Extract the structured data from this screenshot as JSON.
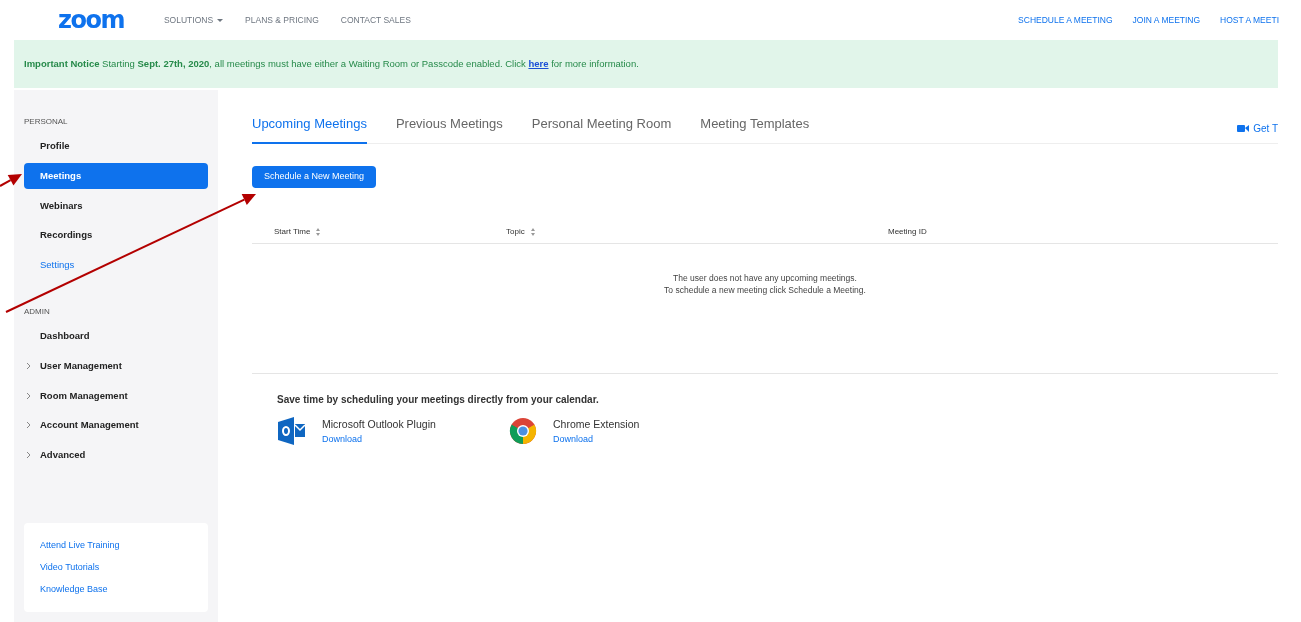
{
  "header": {
    "logo": "zoom",
    "nav": [
      {
        "label": "SOLUTIONS",
        "dropdown": true
      },
      {
        "label": "PLANS & PRICING",
        "dropdown": false
      },
      {
        "label": "CONTACT SALES",
        "dropdown": false
      }
    ],
    "actions": [
      "SCHEDULE A MEETING",
      "JOIN A MEETING",
      "HOST A MEETI"
    ]
  },
  "notice": {
    "text": "**Important Notice** Starting **Sept. 27th, 2020**, all meetings must have either a Waiting Room or Passcode enabled. Click",
    "link": "here",
    "after": "for more information."
  },
  "sidebar": {
    "sections": [
      {
        "title": "PERSONAL",
        "items": [
          {
            "label": "Profile",
            "kind": "page",
            "selected": false
          },
          {
            "label": "Meetings",
            "kind": "page",
            "selected": true
          },
          {
            "label": "Webinars",
            "kind": "page",
            "selected": false
          },
          {
            "label": "Recordings",
            "kind": "page",
            "selected": false
          },
          {
            "label": "Settings",
            "kind": "link",
            "selected": false
          }
        ]
      },
      {
        "title": "ADMIN",
        "items": [
          {
            "label": "Dashboard",
            "kind": "page",
            "selected": false
          },
          {
            "label": "User Management",
            "kind": "group",
            "selected": false
          },
          {
            "label": "Room Management",
            "kind": "group",
            "selected": false
          },
          {
            "label": "Account Management",
            "kind": "group",
            "selected": false
          },
          {
            "label": "Advanced",
            "kind": "group",
            "selected": false
          }
        ]
      }
    ],
    "help_links": [
      "Attend Live Training",
      "Video Tutorials",
      "Knowledge Base"
    ]
  },
  "tabs": [
    {
      "label": "Upcoming Meetings",
      "selected": true
    },
    {
      "label": "Previous Meetings",
      "selected": false
    },
    {
      "label": "Personal Meeting Room",
      "selected": false
    },
    {
      "label": "Meeting Templates",
      "selected": false
    }
  ],
  "get_link": "Get T",
  "schedule_button": "Schedule a New Meeting",
  "table": {
    "columns": [
      {
        "label": "Start Time",
        "sortable": true
      },
      {
        "label": "Topic",
        "sortable": true
      },
      {
        "label": "Meeting ID",
        "sortable": false
      }
    ],
    "empty_message": [
      "The user does not have any upcoming meetings.",
      "To schedule a new meeting click Schedule a Meeting."
    ]
  },
  "calendar": {
    "heading": "Save time by scheduling your meetings directly from your calendar.",
    "plugins": [
      {
        "kind": "outlook",
        "name": "Microsoft Outlook Plugin",
        "link": "Download"
      },
      {
        "kind": "chrome",
        "name": "Chrome Extension",
        "link": "Download"
      }
    ]
  },
  "annotations": [
    {
      "kind": "arrow"
    },
    {
      "kind": "arrow"
    }
  ]
}
